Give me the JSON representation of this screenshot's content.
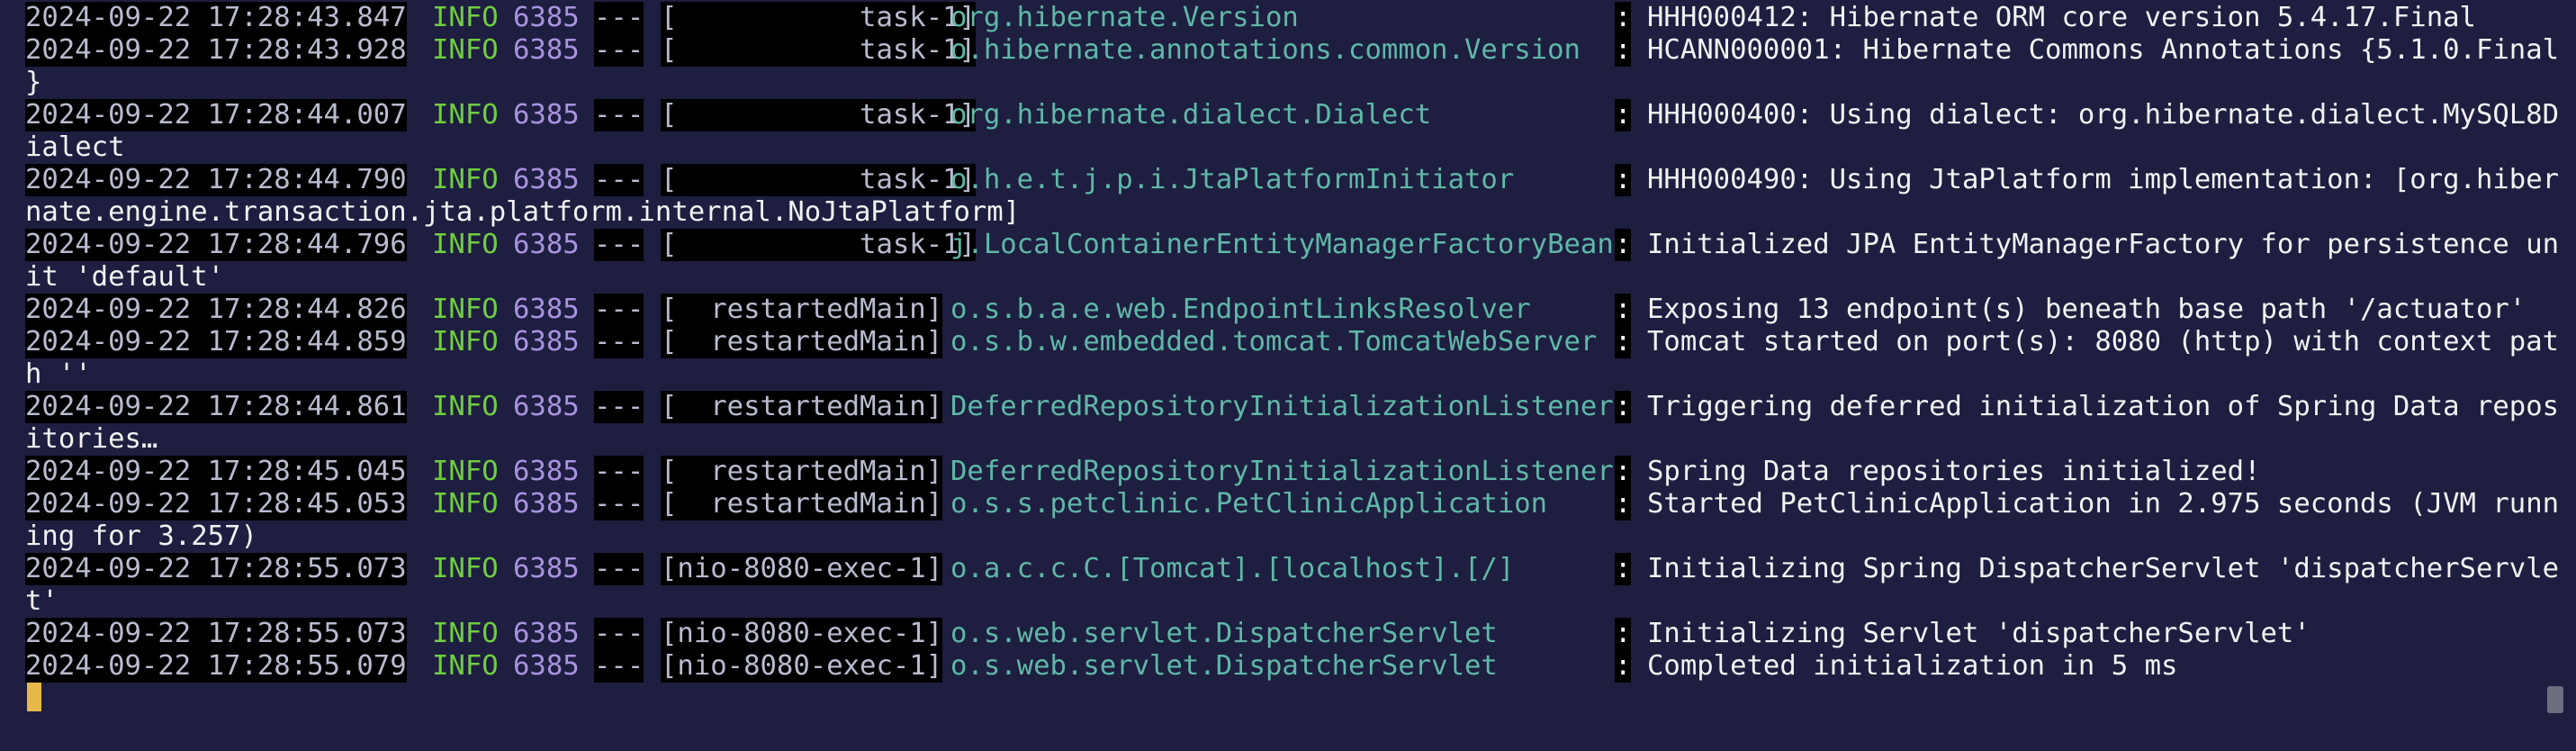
{
  "terminal": {
    "lines": [
      {
        "type": "log",
        "ts": "2024-09-22 17:28:43.847",
        "level": "INFO",
        "pid": "6385",
        "sep": "---",
        "thread": "[           task-1]",
        "logger": "org.hibernate.Version",
        "msg": "HHH000412: Hibernate ORM core version 5.4.17.Final"
      },
      {
        "type": "log",
        "ts": "2024-09-22 17:28:43.928",
        "level": "INFO",
        "pid": "6385",
        "sep": "---",
        "thread": "[           task-1]",
        "logger": "o.hibernate.annotations.common.Version",
        "msg": "HCANN000001: Hibernate Commons Annotations {5.1.0.Final"
      },
      {
        "type": "wrap",
        "text": "}"
      },
      {
        "type": "log",
        "ts": "2024-09-22 17:28:44.007",
        "level": "INFO",
        "pid": "6385",
        "sep": "---",
        "thread": "[           task-1]",
        "logger": "org.hibernate.dialect.Dialect",
        "msg": "HHH000400: Using dialect: org.hibernate.dialect.MySQL8D"
      },
      {
        "type": "wrap",
        "text": "ialect"
      },
      {
        "type": "log",
        "ts": "2024-09-22 17:28:44.790",
        "level": "INFO",
        "pid": "6385",
        "sep": "---",
        "thread": "[           task-1]",
        "logger": "o.h.e.t.j.p.i.JtaPlatformInitiator",
        "msg": "HHH000490: Using JtaPlatform implementation: [org.hiber"
      },
      {
        "type": "wrap",
        "text": "nate.engine.transaction.jta.platform.internal.NoJtaPlatform]"
      },
      {
        "type": "log",
        "ts": "2024-09-22 17:28:44.796",
        "level": "INFO",
        "pid": "6385",
        "sep": "---",
        "thread": "[           task-1]",
        "logger": "j.LocalContainerEntityManagerFactoryBean",
        "msg": "Initialized JPA EntityManagerFactory for persistence un"
      },
      {
        "type": "wrap",
        "text": "it 'default'"
      },
      {
        "type": "log",
        "ts": "2024-09-22 17:28:44.826",
        "level": "INFO",
        "pid": "6385",
        "sep": "---",
        "thread": "[  restartedMain]",
        "logger": "o.s.b.a.e.web.EndpointLinksResolver",
        "msg": "Exposing 13 endpoint(s) beneath base path '/actuator'"
      },
      {
        "type": "log",
        "ts": "2024-09-22 17:28:44.859",
        "level": "INFO",
        "pid": "6385",
        "sep": "---",
        "thread": "[  restartedMain]",
        "logger": "o.s.b.w.embedded.tomcat.TomcatWebServer",
        "msg": "Tomcat started on port(s): 8080 (http) with context pat"
      },
      {
        "type": "wrap",
        "text": "h ''"
      },
      {
        "type": "log",
        "ts": "2024-09-22 17:28:44.861",
        "level": "INFO",
        "pid": "6385",
        "sep": "---",
        "thread": "[  restartedMain]",
        "logger": "DeferredRepositoryInitializationListener",
        "msg": "Triggering deferred initialization of Spring Data repos"
      },
      {
        "type": "wrap",
        "text": "itories…"
      },
      {
        "type": "log",
        "ts": "2024-09-22 17:28:45.045",
        "level": "INFO",
        "pid": "6385",
        "sep": "---",
        "thread": "[  restartedMain]",
        "logger": "DeferredRepositoryInitializationListener",
        "msg": "Spring Data repositories initialized!"
      },
      {
        "type": "log",
        "ts": "2024-09-22 17:28:45.053",
        "level": "INFO",
        "pid": "6385",
        "sep": "---",
        "thread": "[  restartedMain]",
        "logger": "o.s.s.petclinic.PetClinicApplication",
        "msg": "Started PetClinicApplication in 2.975 seconds (JVM runn"
      },
      {
        "type": "wrap",
        "text": "ing for 3.257)"
      },
      {
        "type": "log",
        "ts": "2024-09-22 17:28:55.073",
        "level": "INFO",
        "pid": "6385",
        "sep": "---",
        "thread": "[nio-8080-exec-1]",
        "logger": "o.a.c.c.C.[Tomcat].[localhost].[/]",
        "msg": "Initializing Spring DispatcherServlet 'dispatcherServle"
      },
      {
        "type": "wrap",
        "text": "t'"
      },
      {
        "type": "log",
        "ts": "2024-09-22 17:28:55.073",
        "level": "INFO",
        "pid": "6385",
        "sep": "---",
        "thread": "[nio-8080-exec-1]",
        "logger": "o.s.web.servlet.DispatcherServlet",
        "msg": "Initializing Servlet 'dispatcherServlet'"
      },
      {
        "type": "log",
        "ts": "2024-09-22 17:28:55.079",
        "level": "INFO",
        "pid": "6385",
        "sep": "---",
        "thread": "[nio-8080-exec-1]",
        "logger": "o.s.web.servlet.DispatcherServlet",
        "msg": "Completed initialization in 5 ms"
      }
    ],
    "colon": ":"
  },
  "colors": {
    "background": "#1e1e40",
    "level_info": "#6fcf3e",
    "pid": "#a893e0",
    "logger": "#5fb8a8",
    "cursor": "#e6b94a"
  }
}
